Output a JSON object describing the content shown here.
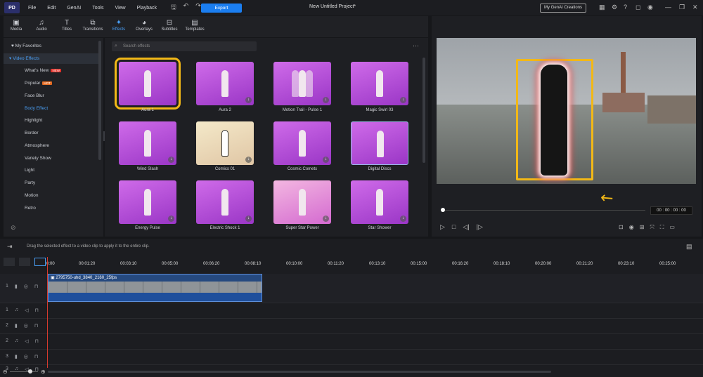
{
  "titlebar": {
    "logo": "PD",
    "menu": [
      "File",
      "Edit",
      "GenAI",
      "Tools",
      "View",
      "Playback"
    ],
    "export": "Export",
    "project_title": "New Untitled Project*",
    "genai_creations": "My GenAI Creations"
  },
  "tabs": [
    {
      "label": "Media",
      "icon": "media-icon"
    },
    {
      "label": "Audio",
      "icon": "audio-icon"
    },
    {
      "label": "Titles",
      "icon": "titles-icon"
    },
    {
      "label": "Transitions",
      "icon": "transitions-icon"
    },
    {
      "label": "Effects",
      "icon": "effects-icon",
      "active": true
    },
    {
      "label": "Overlays",
      "icon": "overlays-icon"
    },
    {
      "label": "Subtitles",
      "icon": "subtitles-icon"
    },
    {
      "label": "Templates",
      "icon": "templates-icon"
    }
  ],
  "sidebar": {
    "favorites": "My Favorites",
    "section": "Video Effects",
    "items": [
      {
        "label": "What's New",
        "badge": "NEW"
      },
      {
        "label": "Popular",
        "badge": "HOT"
      },
      {
        "label": "Face Blur"
      },
      {
        "label": "Body Effect",
        "active": true
      },
      {
        "label": "Highlight"
      },
      {
        "label": "Border"
      },
      {
        "label": "Atmosphere"
      },
      {
        "label": "Variety Show"
      },
      {
        "label": "Light"
      },
      {
        "label": "Party"
      },
      {
        "label": "Motion"
      },
      {
        "label": "Retro"
      }
    ]
  },
  "search": {
    "placeholder": "Search effects"
  },
  "effects": [
    {
      "label": "Aura 1",
      "selected": true
    },
    {
      "label": "Aura 2"
    },
    {
      "label": "Motion Trail - Pulse 1"
    },
    {
      "label": "Magic Swirl 03"
    },
    {
      "label": "Wind Slash"
    },
    {
      "label": "Comics 01"
    },
    {
      "label": "Cosmic Comets"
    },
    {
      "label": "Digital Discs"
    },
    {
      "label": "Energy Pulse"
    },
    {
      "label": "Electric Shock 1"
    },
    {
      "label": "Super Star Power"
    },
    {
      "label": "Star Shower"
    }
  ],
  "preview": {
    "timecode": "00 : 00 : 00 : 00"
  },
  "timeline": {
    "hint": "Drag the selected effect to a video clip to apply it to the entire clip.",
    "ruler": [
      "0:00",
      "00:01:20",
      "00:03:10",
      "00:05:00",
      "00:06:20",
      "00:08:10",
      "00:10:00",
      "00:11:20",
      "00:13:10",
      "00:15:00",
      "00:16:20",
      "00:18:10",
      "00:20:00",
      "00:21:20",
      "00:23:10",
      "00:25:00"
    ],
    "clip_name": "2795750-uhd_3840_2160_25fps",
    "track_numbers": [
      "1",
      "1",
      "2",
      "2",
      "3",
      "3"
    ]
  }
}
